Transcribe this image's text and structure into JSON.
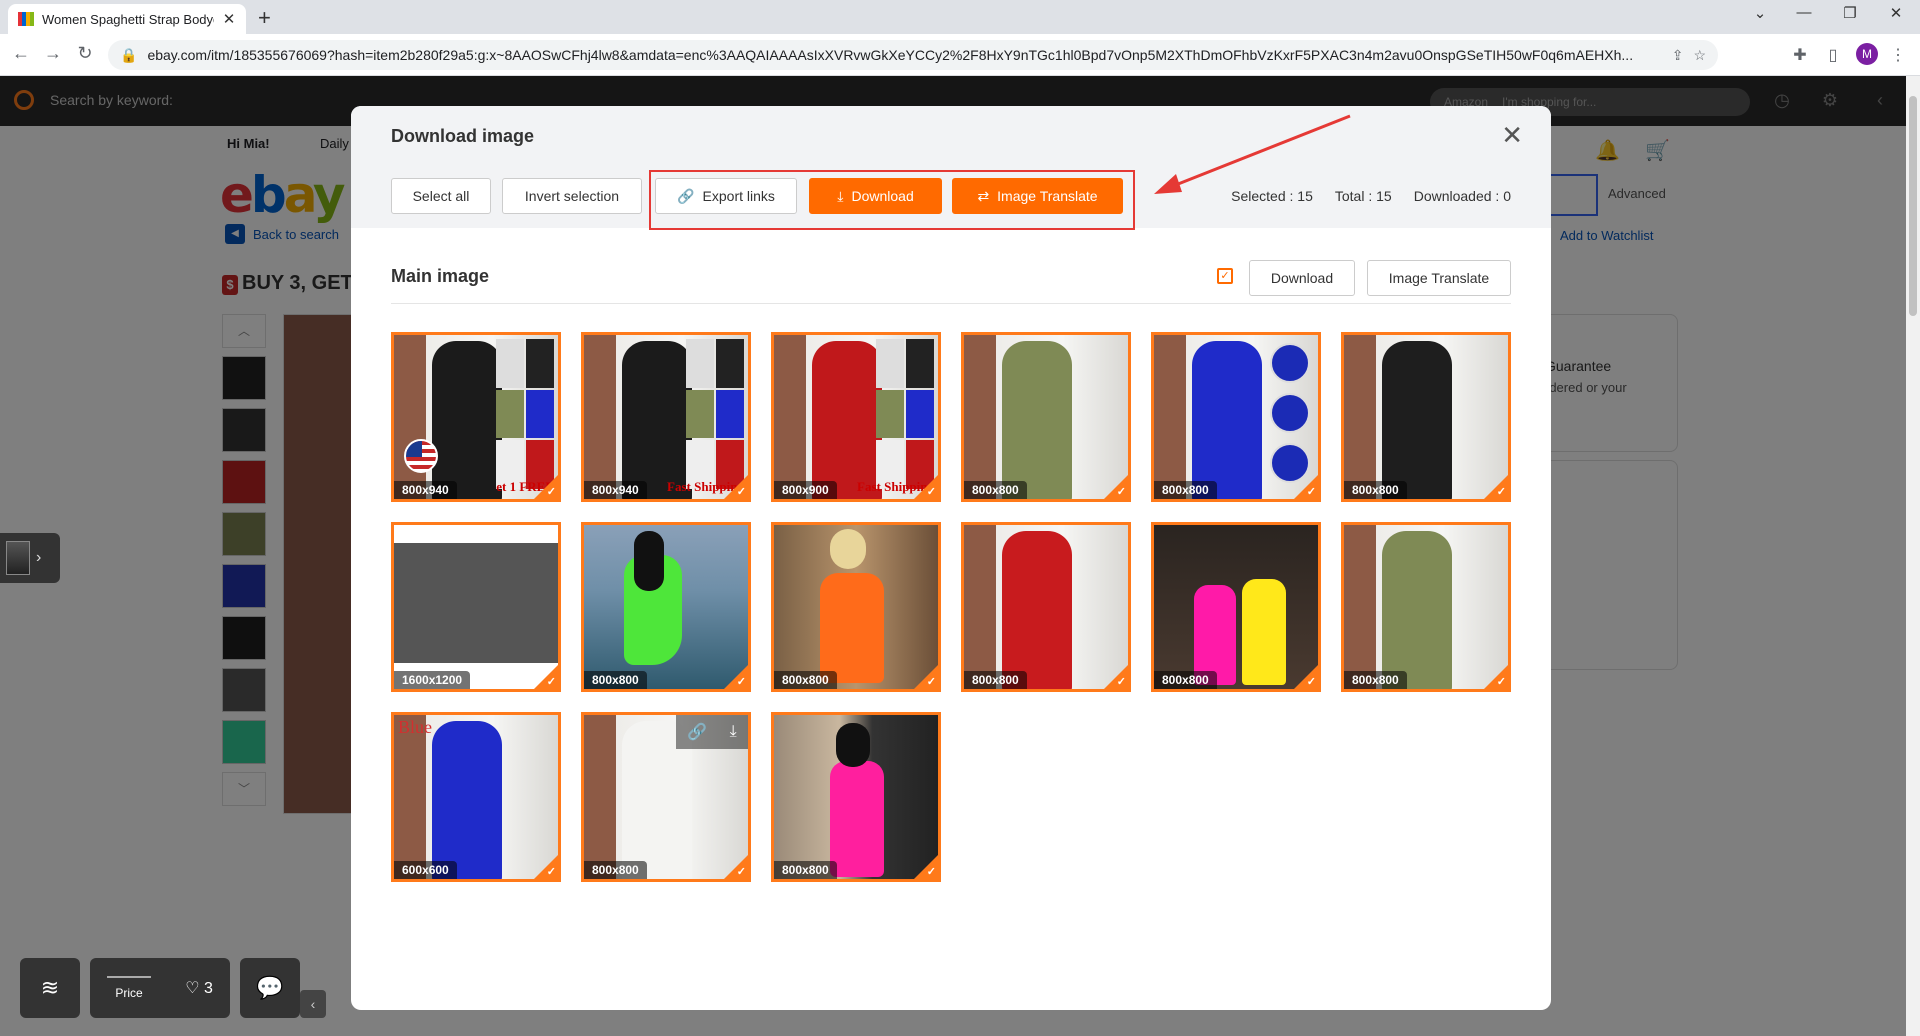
{
  "browser": {
    "tab_title": "Women Spaghetti Strap Bodycon",
    "url": "ebay.com/itm/185355676069?hash=item2b280f29a5:g:x~8AAOSwCFhj4lw8&amdata=enc%3AAQAIAAAAsIxXVRvwGkXeYCCy2%2F8HxY9nTGc1hl0Bpd7vOnp5M2XThDmOFhbVzKxrF5PXAC3n4m2avu0OnspGSeTIH50wF0q6mAEHXh...",
    "profile_initial": "M",
    "new_tab_symbol": "+",
    "close_symbol": "✕"
  },
  "extension_bar": {
    "search_placeholder": "Search by keyword:",
    "marketplace": "Amazon",
    "marketplace_search_placeholder": "I'm shopping for..."
  },
  "background_page": {
    "greeting": "Hi Mia!",
    "daily_link": "Daily",
    "back_to_search": "Back to search",
    "promo_title": "BUY 3, GET",
    "advanced": "Advanced",
    "add_to_watchlist": "Add to Watchlist",
    "guarantee": "Guarantee",
    "guarantee_sub": "rdered or your"
  },
  "bottom_tools": {
    "price_label": "Price",
    "favorites_count": "3"
  },
  "modal": {
    "title": "Download image",
    "toolbar": {
      "select_all": "Select all",
      "invert_selection": "Invert selection",
      "export_links": "Export links",
      "download": "Download",
      "image_translate": "Image Translate"
    },
    "stats": {
      "selected": "Selected : 15",
      "total": "Total : 15",
      "downloaded": "Downloaded : 0"
    },
    "section": {
      "title": "Main image",
      "checked": true,
      "download": "Download",
      "image_translate": "Image Translate"
    },
    "images": [
      {
        "size": "800x940",
        "color": "#1b1b1b",
        "kind": "collage",
        "promo": "et 1 FREE",
        "flag": true
      },
      {
        "size": "800x940",
        "color": "#1b1b1b",
        "kind": "collage",
        "promo": "Fast Shipping"
      },
      {
        "size": "800x900",
        "color": "#c0181b",
        "kind": "collage",
        "promo": "Fast Shipping"
      },
      {
        "size": "800x800",
        "color": "#7f8a55",
        "kind": "dress"
      },
      {
        "size": "800x800",
        "color": "#1f2bc9",
        "kind": "detail"
      },
      {
        "size": "800x800",
        "color": "#1e1e1e",
        "kind": "dress"
      },
      {
        "size": "1600x1200",
        "color": "#555555",
        "kind": "gray"
      },
      {
        "size": "800x800",
        "color": "#4ee63a",
        "kind": "lake"
      },
      {
        "size": "800x800",
        "color": "#ff6b1a",
        "kind": "orange"
      },
      {
        "size": "800x800",
        "color": "#c81b1e",
        "kind": "dress"
      },
      {
        "size": "800x800",
        "color": "#ff1aa8",
        "kind": "duo"
      },
      {
        "size": "800x800",
        "color": "#7f8a55",
        "kind": "dress"
      },
      {
        "size": "600x600",
        "color": "#1f2bc9",
        "kind": "dress",
        "label": "Blue"
      },
      {
        "size": "800x800",
        "color": "#f4f4f2",
        "kind": "dress",
        "hover": true
      },
      {
        "size": "800x800",
        "color": "#ff1f9e",
        "kind": "wall"
      }
    ]
  }
}
